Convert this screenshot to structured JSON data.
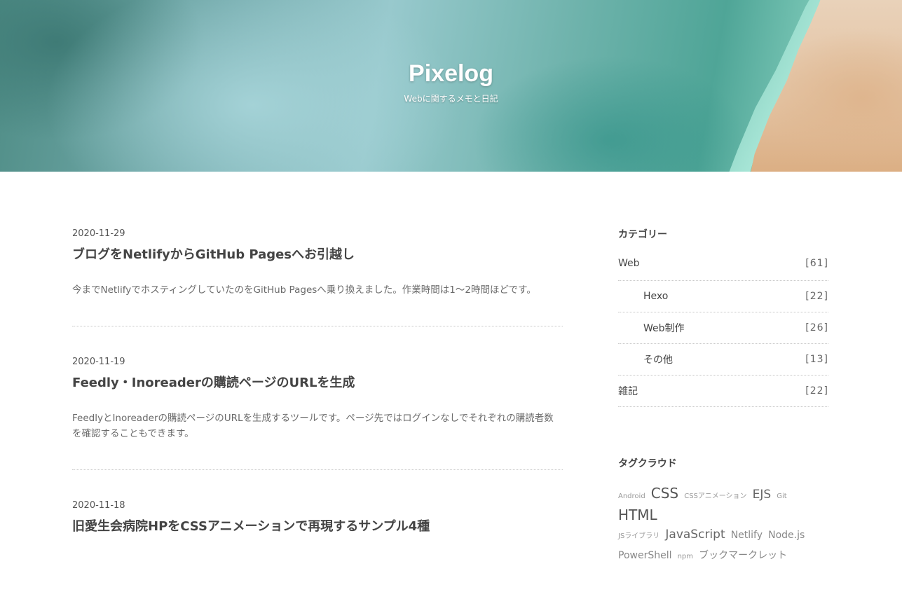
{
  "header": {
    "title": "Pixelog",
    "description": "Webに関するメモと日記"
  },
  "posts": [
    {
      "date": "2020-11-29",
      "title": "ブログをNetlifyからGitHub Pagesへお引越し",
      "excerpt": "今までNetlifyでホスティングしていたのをGitHub Pagesへ乗り換えました。作業時間は1～2時間ほどです。"
    },
    {
      "date": "2020-11-19",
      "title": "Feedly・Inoreaderの購読ページのURLを生成",
      "excerpt": "FeedlyとInoreaderの購読ページのURLを生成するツールです。ページ先ではログインなしでそれぞれの購読者数を確認することもできます。"
    },
    {
      "date": "2020-11-18",
      "title": "旧愛生会病院HPをCSSアニメーションで再現するサンプル4種",
      "excerpt": ""
    }
  ],
  "sidebar": {
    "categories": {
      "title": "カテゴリー",
      "items": [
        {
          "name": "Web",
          "count": "61",
          "child": false
        },
        {
          "name": "Hexo",
          "count": "22",
          "child": true
        },
        {
          "name": "Web制作",
          "count": "26",
          "child": true
        },
        {
          "name": "その他",
          "count": "13",
          "child": true
        },
        {
          "name": "雑記",
          "count": "22",
          "child": false
        }
      ]
    },
    "tags": {
      "title": "タグクラウド",
      "items": [
        {
          "label": "Android",
          "size": "s"
        },
        {
          "label": "CSS",
          "size": "xl"
        },
        {
          "label": "CSSアニメーション",
          "size": "s"
        },
        {
          "label": "EJS",
          "size": "l"
        },
        {
          "label": "Git",
          "size": "s"
        },
        {
          "label": "HTML",
          "size": "xl"
        },
        {
          "label": "JSライブラリ",
          "size": "s"
        },
        {
          "label": "JavaScript",
          "size": "l"
        },
        {
          "label": "Netlify",
          "size": "m"
        },
        {
          "label": "Node.js",
          "size": "m"
        },
        {
          "label": "PowerShell",
          "size": "m"
        },
        {
          "label": "npm",
          "size": "s"
        },
        {
          "label": "ブックマークレット",
          "size": "m"
        }
      ]
    }
  }
}
